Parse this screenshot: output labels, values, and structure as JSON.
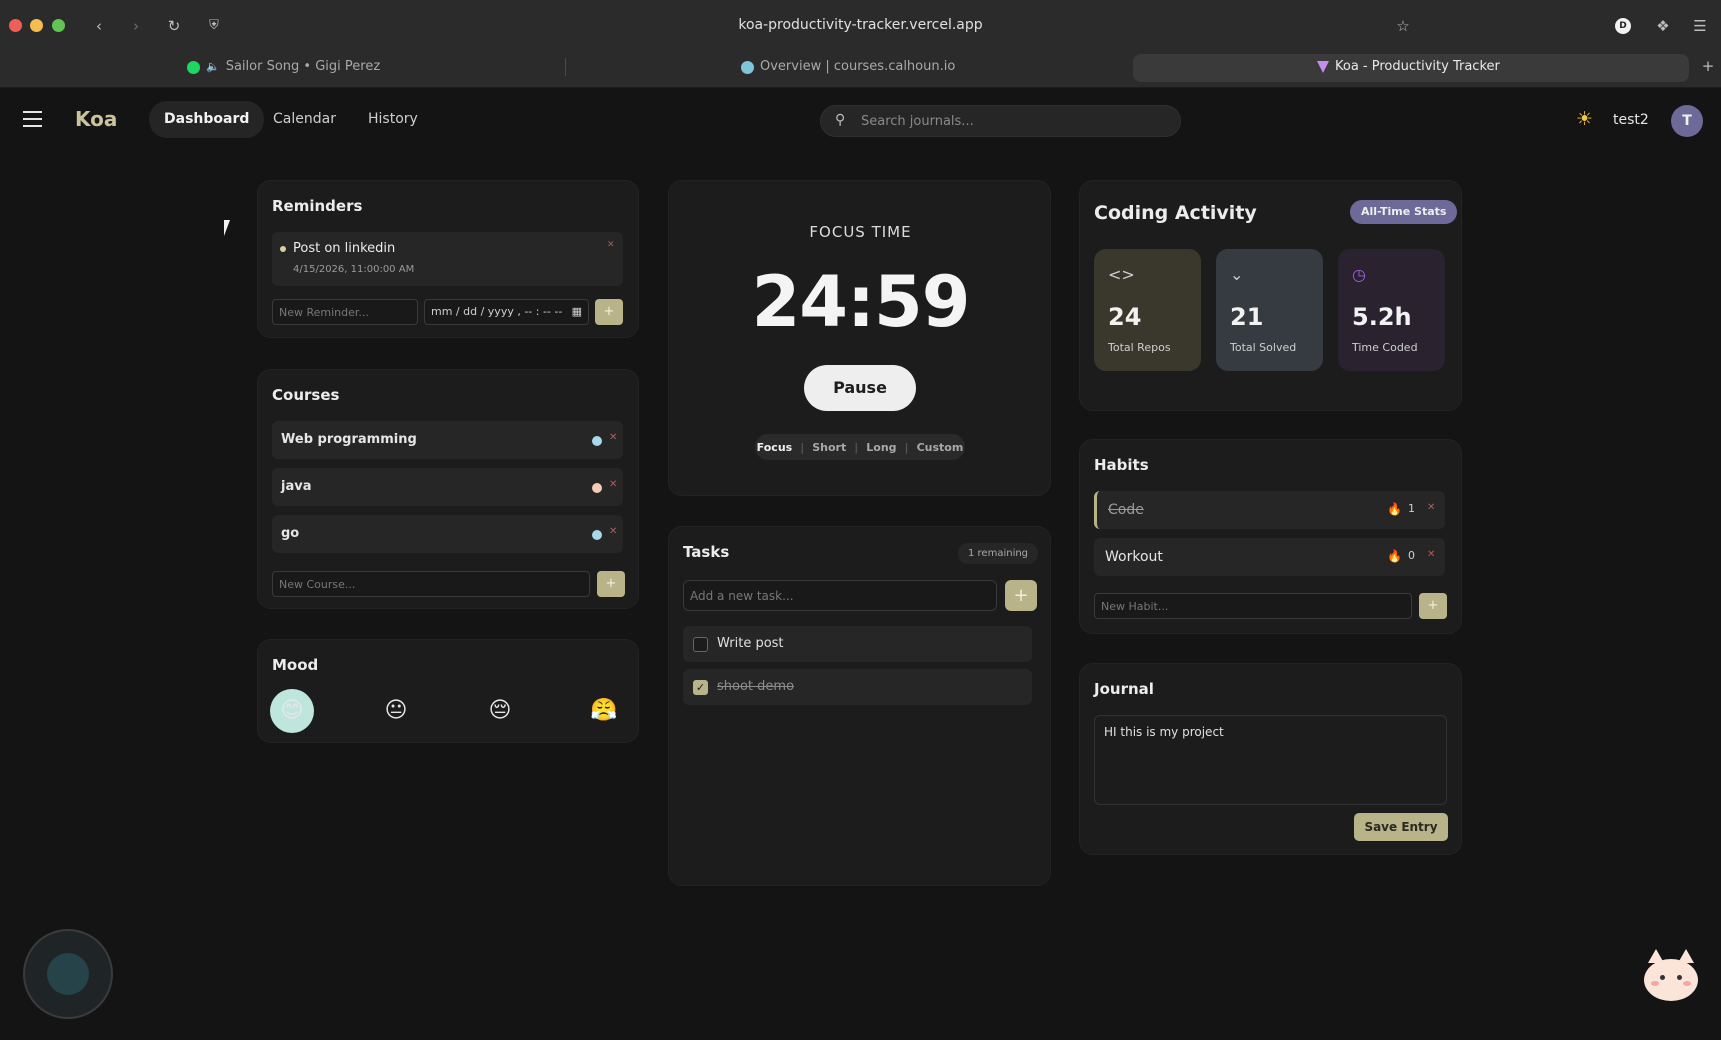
{
  "browser": {
    "url": "koa-productivity-tracker.vercel.app",
    "tabs": [
      {
        "label": "Sailor Song • Gigi Perez",
        "icon": "spotify-icon"
      },
      {
        "label": "Overview | courses.calhoun.io",
        "icon": "gopher-icon"
      },
      {
        "label": "Koa - Productivity Tracker",
        "icon": "koa-icon"
      }
    ],
    "profile_initial": "D"
  },
  "header": {
    "logo": "Koa",
    "nav": [
      "Dashboard",
      "Calendar",
      "History"
    ],
    "search_placeholder": "Search journals...",
    "username": "test2",
    "avatar_initial": "T"
  },
  "reminders": {
    "title": "Reminders",
    "items": [
      {
        "text": "Post on linkedin",
        "datetime": "4/15/2026, 11:00:00 AM"
      }
    ],
    "new_placeholder": "New Reminder...",
    "date_placeholder": "mm / dd / yyyy , -- : -- --",
    "add_label": "+"
  },
  "courses": {
    "title": "Courses",
    "items": [
      {
        "name": "Web programming",
        "color": "#a8d8ea"
      },
      {
        "name": "java",
        "color": "#f6cbb7"
      },
      {
        "name": "go",
        "color": "#a8d8ea"
      }
    ],
    "new_placeholder": "New Course...",
    "add_label": "+"
  },
  "mood": {
    "title": "Mood",
    "options": [
      "😊",
      "😐",
      "😔",
      "😤"
    ],
    "selected_index": 0
  },
  "focus": {
    "title": "FOCUS TIME",
    "time": "24:59",
    "button": "Pause",
    "modes": [
      "Focus",
      "Short",
      "Long",
      "Custom"
    ]
  },
  "tasks": {
    "title": "Tasks",
    "remaining": "1 remaining",
    "input_placeholder": "Add a new task...",
    "add_label": "+",
    "items": [
      {
        "text": "Write post",
        "done": false
      },
      {
        "text": "shoot demo",
        "done": true
      }
    ]
  },
  "coding": {
    "title": "Coding Activity",
    "badge": "All-Time Stats",
    "stats": [
      {
        "value": "24",
        "label": "Total Repos",
        "icon": "code-icon"
      },
      {
        "value": "21",
        "label": "Total Solved",
        "icon": "chevron-down-icon"
      },
      {
        "value": "5.2h",
        "label": "Time Coded",
        "icon": "clock-icon"
      }
    ]
  },
  "habits": {
    "title": "Habits",
    "items": [
      {
        "name": "Code",
        "streak": "1",
        "done": true
      },
      {
        "name": "Workout",
        "streak": "0",
        "done": false
      }
    ],
    "new_placeholder": "New Habit...",
    "add_label": "+"
  },
  "journal": {
    "title": "Journal",
    "text": "HI this is my project",
    "save_label": "Save Entry"
  },
  "colors": {
    "accent": "#b9b38a",
    "background": "#141414",
    "card": "#1c1c1c"
  }
}
